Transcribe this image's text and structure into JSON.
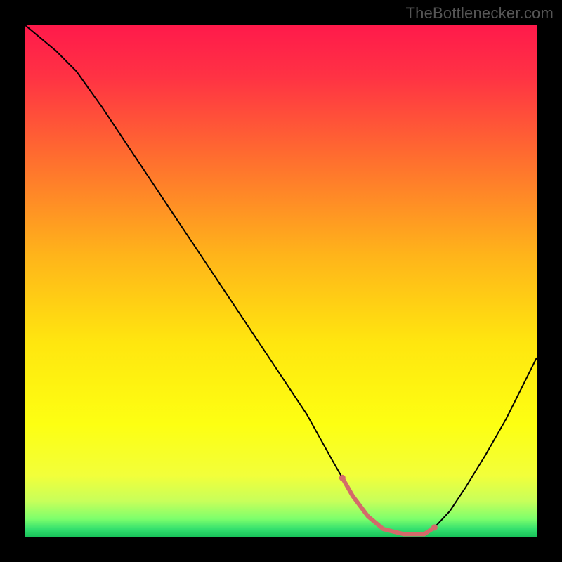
{
  "attribution": "TheBottlenecker.com",
  "chart_data": {
    "type": "line",
    "title": "",
    "xlabel": "",
    "ylabel": "",
    "xlim": [
      0,
      100
    ],
    "ylim": [
      0,
      100
    ],
    "background_gradient": {
      "stops": [
        {
          "offset": 0.0,
          "color": "#ff1a4b"
        },
        {
          "offset": 0.1,
          "color": "#ff3244"
        },
        {
          "offset": 0.25,
          "color": "#ff6a30"
        },
        {
          "offset": 0.45,
          "color": "#ffb41a"
        },
        {
          "offset": 0.62,
          "color": "#ffe60f"
        },
        {
          "offset": 0.78,
          "color": "#fdff12"
        },
        {
          "offset": 0.88,
          "color": "#f2ff3a"
        },
        {
          "offset": 0.93,
          "color": "#c8ff5a"
        },
        {
          "offset": 0.965,
          "color": "#7dff6c"
        },
        {
          "offset": 0.985,
          "color": "#34e06e"
        },
        {
          "offset": 1.0,
          "color": "#18c25a"
        }
      ]
    },
    "series": [
      {
        "name": "bottleneck-curve",
        "color": "#000000",
        "stroke_width": 2,
        "x": [
          0,
          3,
          6,
          10,
          15,
          20,
          25,
          30,
          35,
          40,
          45,
          50,
          55,
          60,
          62,
          64,
          67,
          70,
          74,
          78,
          80,
          83,
          86,
          90,
          94,
          98,
          100
        ],
        "y": [
          100,
          97.5,
          95,
          91,
          84,
          76.5,
          69,
          61.5,
          54,
          46.5,
          39,
          31.5,
          24,
          15,
          11.5,
          8,
          4,
          1.5,
          0.5,
          0.5,
          1.8,
          5,
          9.5,
          16,
          23,
          31,
          35
        ]
      }
    ],
    "highlight": {
      "name": "optimal-range",
      "color": "#d46a6a",
      "stroke_width": 6,
      "dot_radius": 4.5,
      "x": [
        62,
        64,
        67,
        70,
        74,
        78,
        80
      ],
      "y": [
        11.5,
        8,
        4,
        1.5,
        0.5,
        0.5,
        1.8
      ]
    }
  }
}
